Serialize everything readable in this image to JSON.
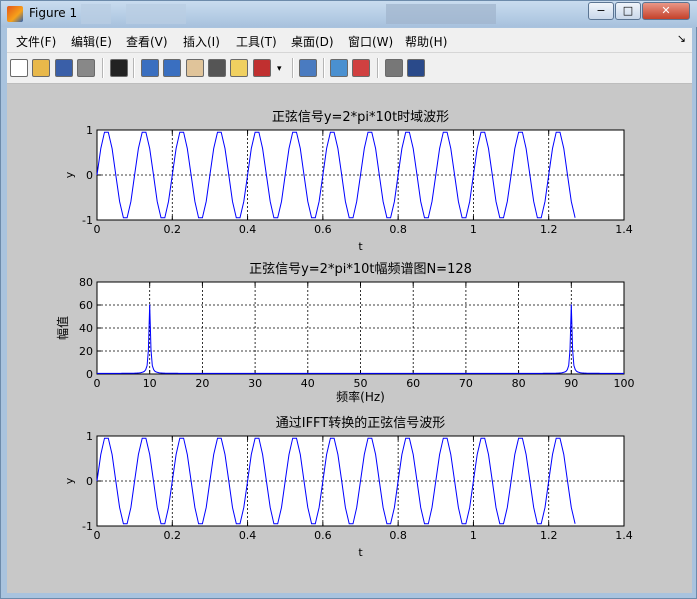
{
  "window": {
    "title": "Figure 1"
  },
  "window_buttons": [
    {
      "name": "minimize-button",
      "glyph": "−"
    },
    {
      "name": "maximize-button",
      "glyph": "□"
    },
    {
      "name": "close-button",
      "glyph": "✕"
    }
  ],
  "menu": [
    "文件(F)",
    "编辑(E)",
    "查看(V)",
    "插入(I)",
    "工具(T)",
    "桌面(D)",
    "窗口(W)",
    "帮助(H)"
  ],
  "toolbar": [
    {
      "name": "new-figure-icon",
      "color": "#ffffff"
    },
    {
      "name": "open-file-icon",
      "color": "#e8b84a"
    },
    {
      "name": "save-icon",
      "color": "#3a5fa8"
    },
    {
      "name": "print-icon",
      "color": "#888888"
    },
    {
      "name": "edit-plot-arrow-icon",
      "color": "#222222"
    },
    {
      "name": "zoom-in-icon",
      "color": "#3a6fc0"
    },
    {
      "name": "zoom-out-icon",
      "color": "#3a6fc0"
    },
    {
      "name": "pan-hand-icon",
      "color": "#e0c49a"
    },
    {
      "name": "rotate-3d-icon",
      "color": "#555555"
    },
    {
      "name": "data-cursor-icon",
      "color": "#f0d060"
    },
    {
      "name": "brush-icon",
      "color": "#c03030"
    },
    {
      "name": "brush-dropdown-icon",
      "color": "#333333"
    },
    {
      "name": "link-plot-icon",
      "color": "#4a7bc0"
    },
    {
      "name": "insert-colorbar-icon",
      "color": "#4a90d0"
    },
    {
      "name": "insert-legend-icon",
      "color": "#d04040"
    },
    {
      "name": "hide-plot-tools-icon",
      "color": "#777777"
    },
    {
      "name": "show-plot-tools-icon",
      "color": "#2a4a8a"
    }
  ],
  "chart_data": [
    {
      "type": "line",
      "title": "正弦信号y=2*pi*10t时域波形",
      "xlabel": "t",
      "ylabel": "y",
      "xlim": [
        0,
        1.4
      ],
      "ylim": [
        -1,
        1
      ],
      "xticks": [
        "0",
        "0.2",
        "0.4",
        "0.6",
        "0.8",
        "1",
        "1.2",
        "1.4"
      ],
      "yticks": [
        "-1",
        "0",
        "1"
      ],
      "grid": true,
      "color": "#0000ff",
      "series": [
        {
          "function": "sin(2*pi*10*t)",
          "t_start": 0,
          "t_end": 1.27,
          "samples": 128
        }
      ]
    },
    {
      "type": "line",
      "title": "正弦信号y=2*pi*10t幅频谱图N=128",
      "xlabel": "频率(Hz)",
      "ylabel": "幅值",
      "xlim": [
        0,
        100
      ],
      "ylim": [
        0,
        80
      ],
      "xticks": [
        "0",
        "10",
        "20",
        "30",
        "40",
        "50",
        "60",
        "70",
        "80",
        "90",
        "100"
      ],
      "yticks": [
        "0",
        "20",
        "40",
        "60",
        "80"
      ],
      "grid": true,
      "color": "#0000ff",
      "series": [
        {
          "peaks": [
            {
              "x": 10,
              "y": 60
            },
            {
              "x": 90,
              "y": 60
            }
          ],
          "baseline": 0.5
        }
      ]
    },
    {
      "type": "line",
      "title": "通过IFFT转换的正弦信号波形",
      "xlabel": "t",
      "ylabel": "y",
      "xlim": [
        0,
        1.4
      ],
      "ylim": [
        -1,
        1
      ],
      "xticks": [
        "0",
        "0.2",
        "0.4",
        "0.6",
        "0.8",
        "1",
        "1.2",
        "1.4"
      ],
      "yticks": [
        "-1",
        "0",
        "1"
      ],
      "grid": true,
      "color": "#0000ff",
      "series": [
        {
          "function": "sin(2*pi*10*t)",
          "t_start": 0,
          "t_end": 1.27,
          "samples": 128
        }
      ]
    }
  ]
}
